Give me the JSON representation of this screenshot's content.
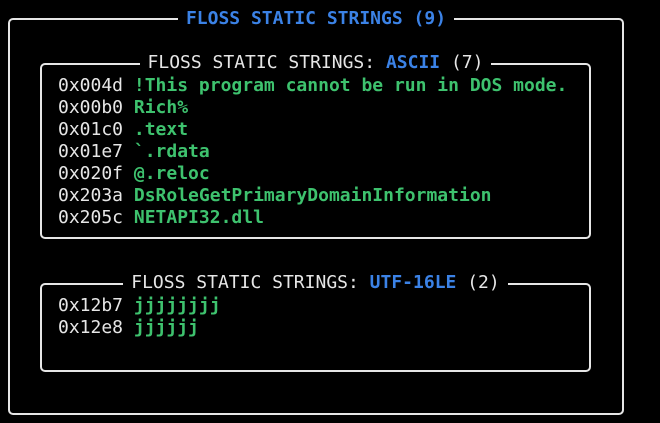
{
  "outer": {
    "title": "FLOSS STATIC STRINGS (9)"
  },
  "ascii": {
    "title_prefix": "FLOSS STATIC STRINGS: ",
    "encoding": "ASCII",
    "count": " (7)",
    "rows": [
      {
        "addr": "0x004d",
        "value": "!This program cannot be run in DOS mode."
      },
      {
        "addr": "0x00b0",
        "value": "Rich%"
      },
      {
        "addr": "0x01c0",
        "value": ".text"
      },
      {
        "addr": "0x01e7",
        "value": "`.rdata"
      },
      {
        "addr": "0x020f",
        "value": "@.reloc"
      },
      {
        "addr": "0x203a",
        "value": "DsRoleGetPrimaryDomainInformation"
      },
      {
        "addr": "0x205c",
        "value": "NETAPI32.dll"
      }
    ]
  },
  "utf16": {
    "title_prefix": "FLOSS STATIC STRINGS: ",
    "encoding": "UTF-16LE",
    "count": " (2)",
    "rows": [
      {
        "addr": "0x12b7",
        "value": "jjjjjjjj"
      },
      {
        "addr": "0x12e8",
        "value": "jjjjjj"
      }
    ]
  },
  "colors": {
    "background": "#000000",
    "border": "#e6e6e6",
    "heading": "#3b82e6",
    "string": "#3ec26e"
  }
}
